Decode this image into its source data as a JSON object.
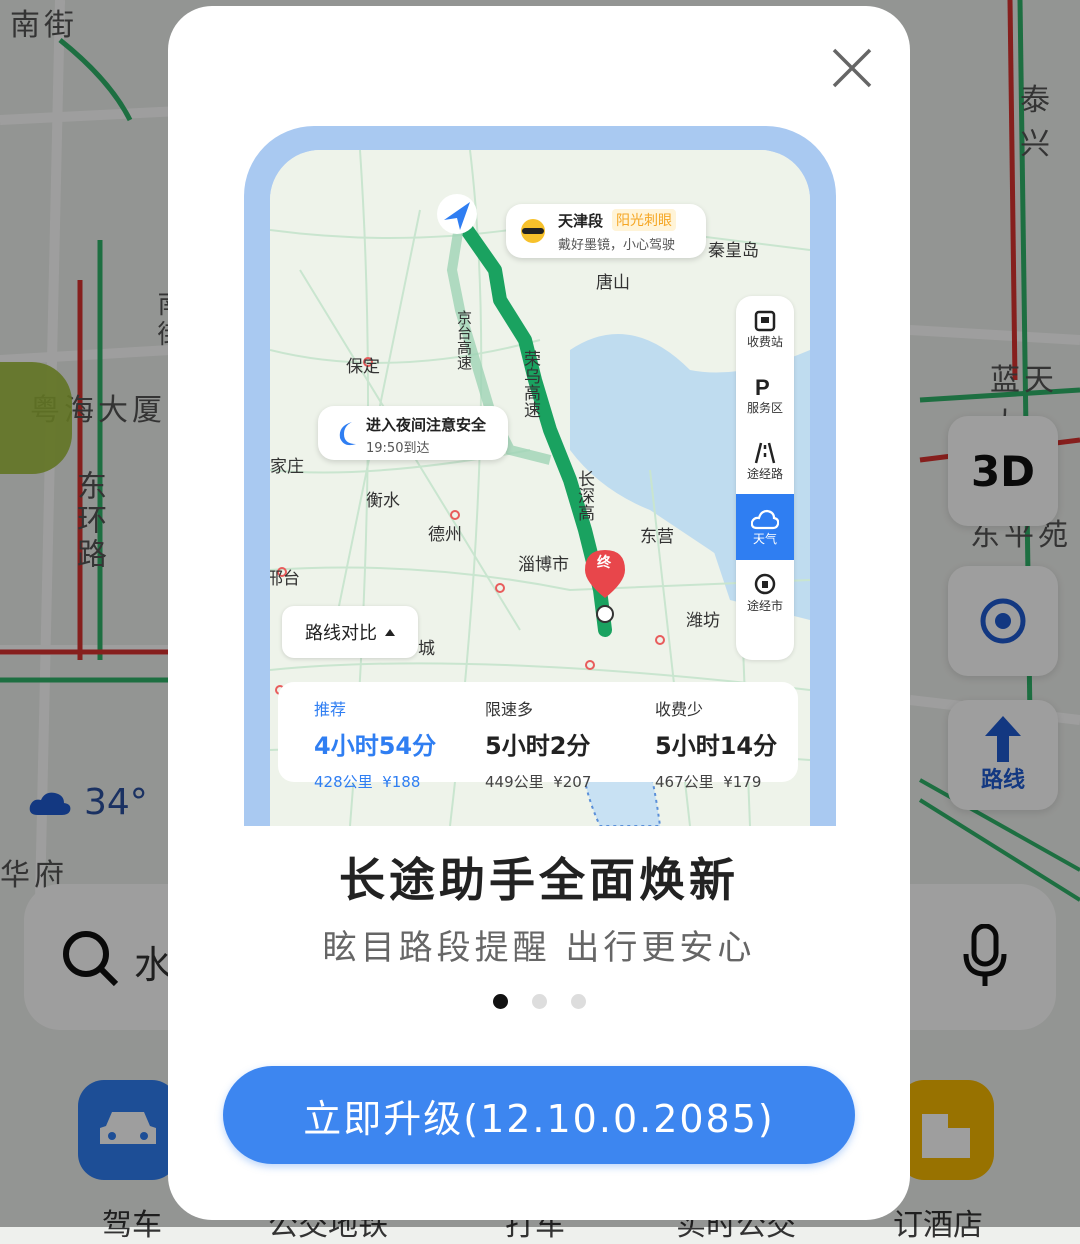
{
  "background": {
    "labels": {
      "street_top": "南街",
      "place_taixing": "泰兴",
      "place_yuehai": "粤海大厦",
      "place_lantian": "蓝天大",
      "road_east_ring": "东环路",
      "place_dongping": "东平苑",
      "place_huafu": "华府",
      "street_vertical": "南街"
    },
    "buttons": {
      "btn_3d": "3D",
      "route": "路线"
    },
    "weather": {
      "temp": "34°"
    },
    "search": {
      "partial_text": "水"
    },
    "bottom_shortcuts": [
      "驾车",
      "公交地铁",
      "打车",
      "实时公交",
      "订酒店"
    ]
  },
  "dialog": {
    "preview": {
      "map_labels": {
        "tianjin_section": "天津段",
        "sun_glare": "阳光刺眼",
        "sunglasses_tip": "戴好墨镜，小心驾驶",
        "qinhuangdao": "秦皇岛",
        "tangshan": "唐山",
        "jingtai_highway": "京台高速",
        "rongwu_highway": "荣乌高速",
        "changshen_highway": "长深高",
        "baoding": "保定",
        "night_alert": "进入夜间注意安全",
        "night_arrival": "19:50到达",
        "jiazhuang": "家庄",
        "hengshui": "衡水",
        "dezhou": "德州",
        "zibo": "淄博市",
        "dongying": "东营",
        "weifang": "潍坊",
        "terminal": "终",
        "xingtai": "邢台",
        "cheng": "城"
      },
      "toolbar": [
        {
          "label": "收费站",
          "icon": "toll-station-icon"
        },
        {
          "label": "服务区",
          "icon": "service-area-icon"
        },
        {
          "label": "途经路",
          "icon": "road-icon"
        },
        {
          "label": "天气",
          "icon": "weather-cloud-icon",
          "active": true
        },
        {
          "label": "途经市",
          "icon": "city-icon"
        }
      ],
      "compare_button": "路线对比",
      "routes": [
        {
          "tag": "推荐",
          "time": "4小时54分",
          "distance": "428公里",
          "cost": "¥188",
          "selected": true
        },
        {
          "tag": "限速多",
          "time": "5小时2分",
          "distance": "449公里",
          "cost": "¥207",
          "selected": false
        },
        {
          "tag": "收费少",
          "time": "5小时14分",
          "distance": "467公里",
          "cost": "¥179",
          "selected": false
        }
      ]
    },
    "title": "长途助手全面焕新",
    "subtitle": "眩目路段提醒 出行更安心",
    "page_dots": {
      "count": 3,
      "active_index": 0
    },
    "upgrade_button": "立即升级(12.10.0.2085)"
  },
  "colors": {
    "accent": "#3d86f0",
    "route_green": "#1aa260",
    "warning_orange": "#f5a623"
  }
}
